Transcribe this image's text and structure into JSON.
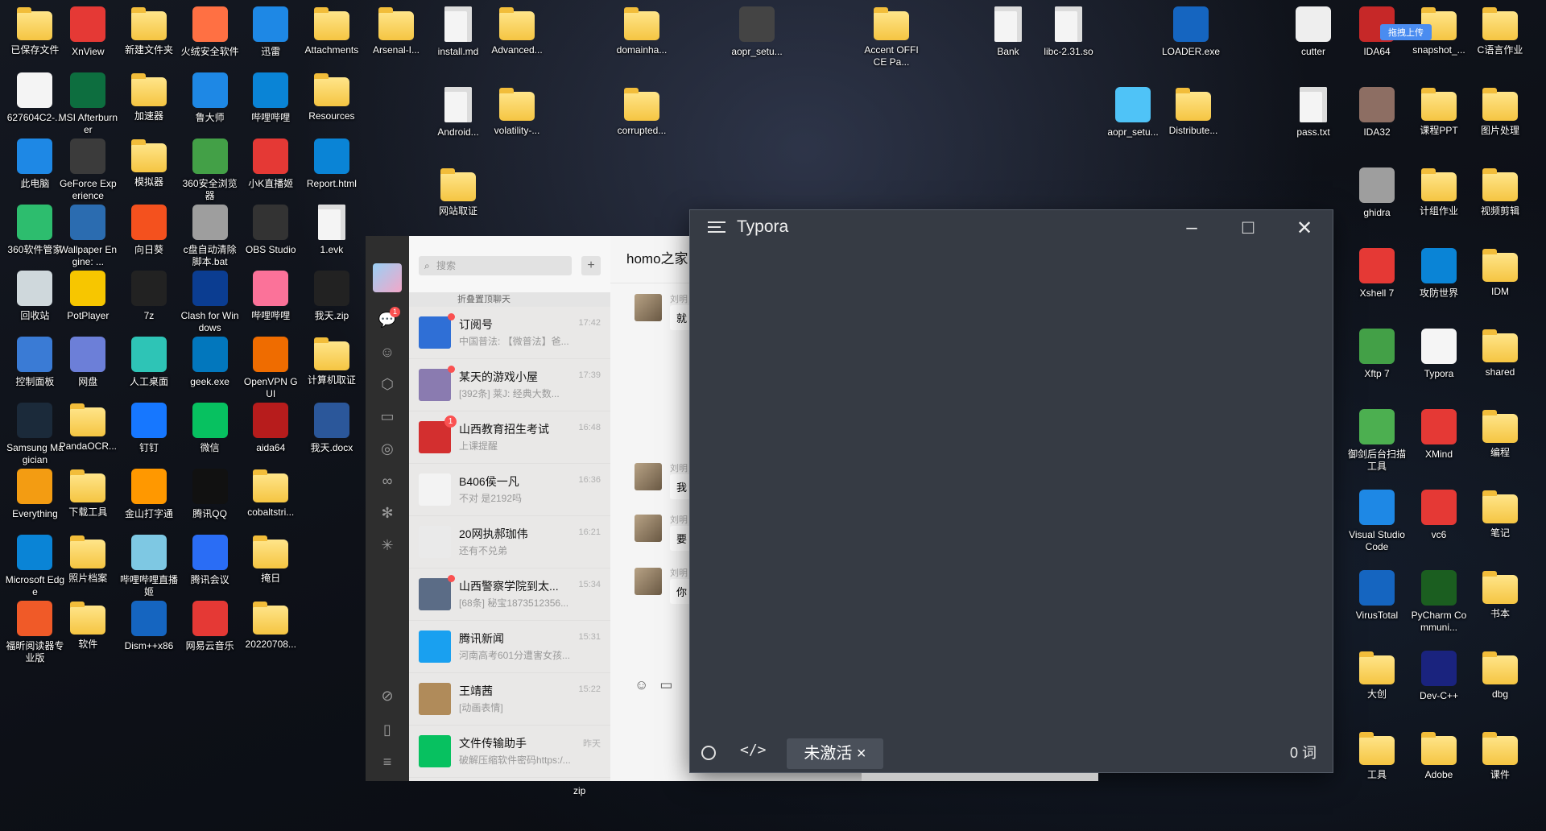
{
  "desktop": {
    "col1": [
      "已保存文件",
      "627604C2-...",
      "此电脑",
      "360软件管家",
      "回收站",
      "控制面板",
      "Samsung Magician",
      "Everything",
      "Microsoft Edge",
      "福昕阅读器专业版"
    ],
    "col2": [
      "XnView",
      "MSI Afterburner",
      "GeForce Experience",
      "Wallpaper Engine: ...",
      "PotPlayer",
      "网盘",
      "PandaOCR...",
      "下载工具",
      "照片档案",
      "软件"
    ],
    "col3": [
      "新建文件夹",
      "加速器",
      "模拟器",
      "向日葵",
      "7z",
      "人工桌面",
      "钉钉",
      "金山打字通",
      "哔哩哔哩直播姬",
      "Dism++x86"
    ],
    "col4": [
      "火绒安全软件",
      "鲁大师",
      "360安全浏览器",
      "c盘自动清除脚本.bat",
      "Clash for Windows",
      "geek.exe",
      "微信",
      "腾讯QQ",
      "腾讯会议",
      "网易云音乐"
    ],
    "col5": [
      "迅雷",
      "哔哩哔哩",
      "小K直播姬",
      "OBS Studio",
      "哔哩哔哩",
      "OpenVPN GUI",
      "aida64",
      "cobaltstri...",
      "掩日",
      "20220708..."
    ],
    "col6": [
      "Attachments",
      "Resources",
      "Report.html",
      "1.evk",
      "我天.zip",
      "计算机取证",
      "我天.docx"
    ],
    "top_row": [
      "Arsenal-I...",
      "install.md",
      "Advanced...",
      "domainha...",
      "aopr_setu...",
      "Accent OFFICE Pa...",
      "Bank",
      "libc-2.31.so",
      "LOADER.exe",
      "cutter"
    ],
    "row2": [
      "Android...",
      "volatility-...",
      "corrupted...",
      "aopr_setu...",
      "Distribute...",
      "pass.txt"
    ],
    "row3": [
      "网站取证"
    ],
    "right1": [
      "IDA64",
      "IDA32",
      "ghidra",
      "Xshell 7",
      "Xftp 7",
      "御剑后台扫描工具",
      "Visual Studio Code",
      "VirusTotal",
      "大创",
      "工具"
    ],
    "right2": [
      "snapshot_...",
      "课程PPT",
      "计组作业",
      "攻防世界",
      "Typora",
      "XMind",
      "vc6",
      "PyCharm Communi...",
      "Dev-C++",
      "Adobe"
    ],
    "right3": [
      "C语言作业",
      "图片处理",
      "视频剪辑",
      "IDM",
      "shared",
      "编程",
      "笔记",
      "书本",
      "dbg",
      "课件"
    ],
    "upload_badge": "拖拽上传",
    "bottom_label": "zip"
  },
  "wechat": {
    "search_placeholder": "搜索",
    "fold_label": "折叠置顶聊天",
    "chat_title": "homo之家",
    "chats": [
      {
        "name": "订阅号",
        "preview": "中国普法: 【微普法】爸...",
        "time": "17:42"
      },
      {
        "name": "某天的游戏小屋",
        "preview": "[392条] 莱J: 经典大数...",
        "time": "17:39"
      },
      {
        "name": "山西教育招生考试",
        "preview": "上课提醒",
        "time": "16:48"
      },
      {
        "name": "B406侯一凡",
        "preview": "不对 是2192吗",
        "time": "16:36"
      },
      {
        "name": "20网执郝珈伟",
        "preview": "还有不兑弟",
        "time": "16:21"
      },
      {
        "name": "山西警察学院到太...",
        "preview": "[68条] 秘宝1873512356...",
        "time": "15:34"
      },
      {
        "name": "腾讯新闻",
        "preview": "河南高考601分遭害女孩...",
        "time": "15:31"
      },
      {
        "name": "王靖茜",
        "preview": "[动画表情]",
        "time": "15:22"
      },
      {
        "name": "文件传输助手",
        "preview": "破解压缩软件密码https:/...",
        "time": "昨天"
      }
    ],
    "messages": [
      {
        "name": "刘明",
        "text": "就"
      },
      {
        "name": "刘明",
        "text": "我"
      },
      {
        "name": "刘明",
        "text": "要"
      },
      {
        "name": "刘明",
        "text": "你"
      }
    ],
    "unread_badge": "1"
  },
  "typora": {
    "title": "Typora",
    "activate_label": "未激活 ×",
    "word_count": "0 词",
    "code_toggle": "</>"
  }
}
